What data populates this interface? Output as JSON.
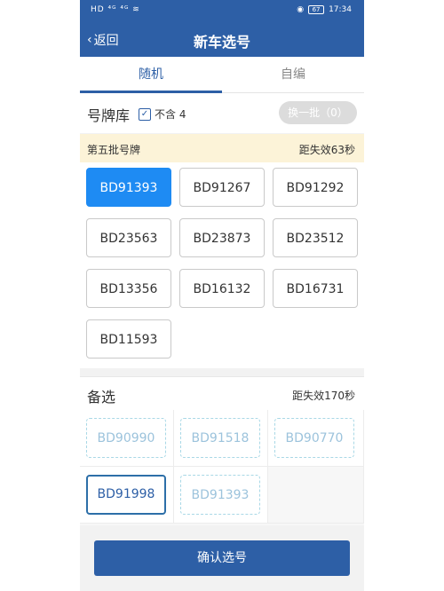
{
  "status_bar": {
    "left": "HD ⁴ᴳ ⁴ᴳ ≋",
    "battery": "67",
    "time": "17:34"
  },
  "header": {
    "back_label": "返回",
    "title": "新车选号"
  },
  "tabs": [
    {
      "label": "随机"
    },
    {
      "label": "自编"
    }
  ],
  "pool": {
    "title": "号牌库",
    "exclude_4_label": "不含 4",
    "swap_button": "换一批（0）",
    "batch_label": "第五批号牌",
    "batch_expire": "距失效63秒",
    "plates": [
      "BD91393",
      "BD91267",
      "BD91292",
      "BD23563",
      "BD23873",
      "BD23512",
      "BD13356",
      "BD16132",
      "BD16731",
      "BD11593"
    ]
  },
  "spare": {
    "title": "备选",
    "expire": "距失效170秒",
    "plates": [
      "BD90990",
      "BD91518",
      "BD90770",
      "BD91998",
      "BD91393"
    ]
  },
  "confirm_label": "确认选号",
  "colors": {
    "primary": "#2d5fa6",
    "selected": "#1e8bf3",
    "banner": "#fcf3d8"
  }
}
